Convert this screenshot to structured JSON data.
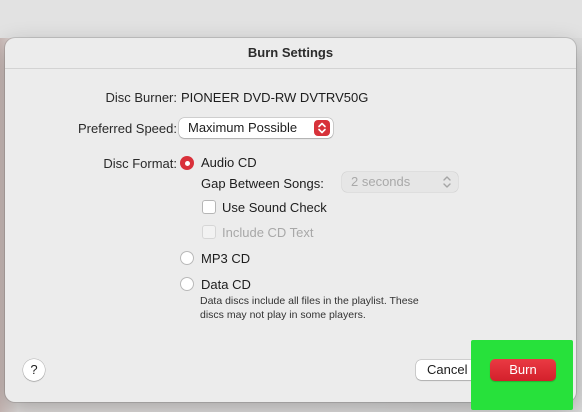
{
  "dialog": {
    "title": "Burn Settings",
    "disc_burner_label": "Disc Burner:",
    "disc_burner_value": "PIONEER DVD-RW DVTRV50G",
    "preferred_speed_label": "Preferred Speed:",
    "preferred_speed_value": "Maximum Possible",
    "disc_format_label": "Disc Format:",
    "formats": {
      "audio_cd": "Audio CD",
      "mp3_cd": "MP3 CD",
      "data_cd": "Data CD",
      "selected": "Audio CD"
    },
    "gap_label": "Gap Between Songs:",
    "gap_value": "2 seconds",
    "use_sound_check": "Use Sound Check",
    "include_cd_text": "Include CD Text",
    "data_note_line1": "Data discs include all files in the playlist. These",
    "data_note_line2": "discs may not play in some players.",
    "help_label": "?",
    "cancel_label": "Cancel",
    "burn_label": "Burn"
  },
  "colors": {
    "accent": "#d9303a",
    "highlight": "#27e13b"
  },
  "icons": {
    "speed_popup": "up-down-chevron-icon",
    "gap_popup": "up-down-chevron-icon"
  }
}
